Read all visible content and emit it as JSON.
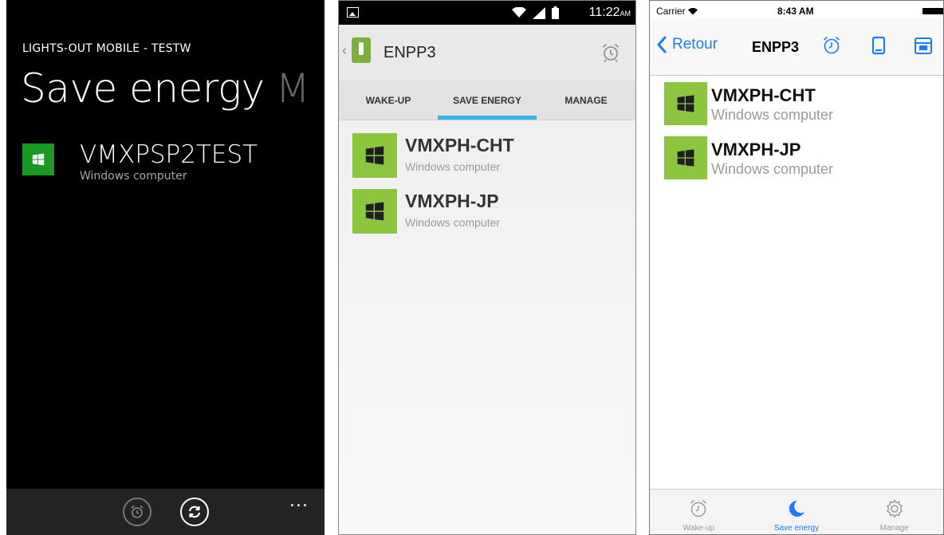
{
  "windows_phone": {
    "app_title": "LIGHTS-OUT MOBILE - TESTW",
    "pivot_current": "Save energy",
    "pivot_next": "M",
    "items": [
      {
        "name": "VMXPSP2TEST",
        "subtitle": "Windows computer",
        "icon": "windows-logo-icon"
      }
    ],
    "appbar": {
      "buttons": [
        "alarm-icon",
        "sync-icon"
      ],
      "more": "..."
    },
    "colors": {
      "background": "#000000",
      "tile": "#1a9a23"
    }
  },
  "android": {
    "status": {
      "time": "11:22",
      "ampm": "AM",
      "icons": [
        "image-icon",
        "wifi-icon",
        "signal-icon",
        "battery-icon"
      ]
    },
    "title": "ENPP3",
    "tabs": [
      {
        "label": "WAKE-UP",
        "active": false
      },
      {
        "label": "SAVE ENERGY",
        "active": true
      },
      {
        "label": "MANAGE",
        "active": false
      }
    ],
    "items": [
      {
        "name": "VMXPH-CHT",
        "subtitle": "Windows computer",
        "icon": "windows-logo-icon"
      },
      {
        "name": "VMXPH-JP",
        "subtitle": "Windows computer",
        "icon": "windows-logo-icon"
      }
    ],
    "colors": {
      "accent": "#33b5e5",
      "tile": "#8cc63f"
    }
  },
  "ios": {
    "status": {
      "carrier": "Carrier",
      "time": "8:43 AM"
    },
    "back_label": "Retour",
    "title": "ENPP3",
    "nav_icons": [
      "alarm-icon",
      "tablet-icon",
      "calendar-icon"
    ],
    "items": [
      {
        "name": "VMXPH-CHT",
        "subtitle": "Windows computer",
        "icon": "windows-logo-icon"
      },
      {
        "name": "VMXPH-JP",
        "subtitle": "Windows computer",
        "icon": "windows-logo-icon"
      }
    ],
    "tabs": [
      {
        "label": "Wake-up",
        "icon": "alarm-icon",
        "active": false
      },
      {
        "label": "Save energy",
        "icon": "moon-icon",
        "active": true
      },
      {
        "label": "Manage",
        "icon": "gear-icon",
        "active": false
      }
    ],
    "colors": {
      "accent": "#1a7cf9",
      "tile": "#8cc63f"
    }
  }
}
